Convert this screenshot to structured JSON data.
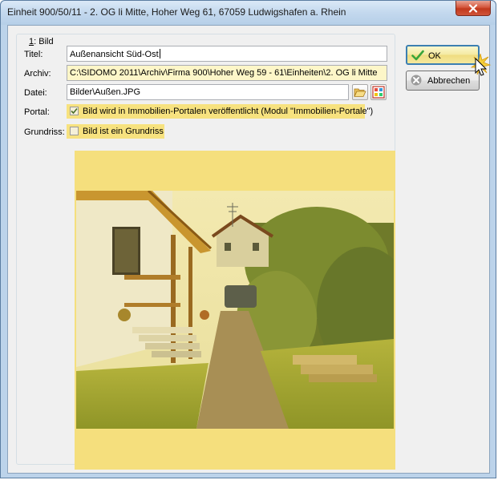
{
  "window": {
    "title": "Einheit 900/50/11 - 2. OG li Mitte, Hoher Weg 61, 67059 Ludwigshafen a. Rhein"
  },
  "group": {
    "legend_mnemonic": "1",
    "legend_rest": ": Bild"
  },
  "fields": {
    "titel_label": "Titel:",
    "titel_value": "Außenansicht Süd-Ost",
    "archiv_label": "Archiv:",
    "archiv_value": "C:\\SIDOMO 2011\\Archiv\\Firma 900\\Hoher Weg 59 - 61\\Einheiten\\2. OG li Mitte",
    "datei_label": "Datei:",
    "datei_value": "Bilder\\Außen.JPG",
    "portal_label": "Portal:",
    "portal_text": "Bild wird in Immobilien-Portalen veröffentlicht (Modul \"Immobilien-Portale\")",
    "portal_checked": true,
    "grundriss_label": "Grundriss:",
    "grundriss_text": "Bild ist ein Grundriss",
    "grundriss_checked": false
  },
  "buttons": {
    "ok_label": "OK",
    "cancel_label": "Abbrechen"
  },
  "icons": {
    "browse": "folder-open-icon",
    "picture": "image-icon",
    "ok": "checkmark-icon",
    "cancel": "x-icon",
    "close": "close-icon"
  },
  "colors": {
    "highlight": "#f7e27f",
    "field_yellow": "#fdf6c8",
    "ok_check": "#3aa53a",
    "cancel_x": "#7a7a7a",
    "close_button": "#c9462a"
  }
}
